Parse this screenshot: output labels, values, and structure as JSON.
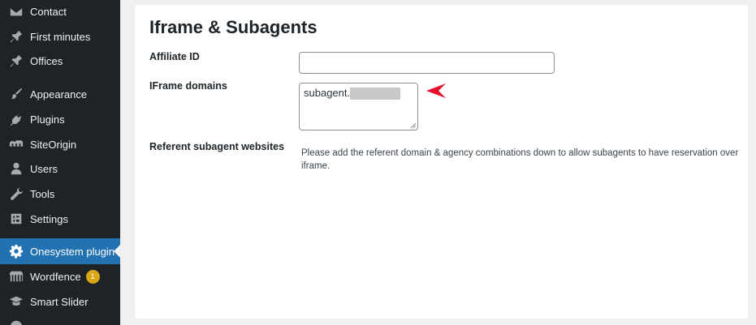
{
  "sidebar": {
    "items": [
      {
        "label": "Contact",
        "icon": "envelope-icon"
      },
      {
        "label": "First minutes",
        "icon": "pin-icon"
      },
      {
        "label": "Offices",
        "icon": "pin-icon"
      },
      {
        "label": "Appearance",
        "icon": "paintbrush-icon"
      },
      {
        "label": "Plugins",
        "icon": "plug-icon"
      },
      {
        "label": "SiteOrigin",
        "icon": "siteorigin-icon"
      },
      {
        "label": "Users",
        "icon": "user-icon"
      },
      {
        "label": "Tools",
        "icon": "wrench-icon"
      },
      {
        "label": "Settings",
        "icon": "settings-icon"
      },
      {
        "label": "Onesystem plugin",
        "icon": "gear-icon",
        "active": true
      },
      {
        "label": "Wordfence",
        "icon": "wordfence-icon",
        "badge": "1"
      },
      {
        "label": "Smart Slider",
        "icon": "graduation-cap-icon"
      }
    ],
    "colors": {
      "background": "#1d2327",
      "active": "#2271b1",
      "text": "#f0f0f1",
      "icon": "#a7aaad",
      "badge": "#dba617"
    }
  },
  "main": {
    "title": "Iframe & Subagents",
    "fields": {
      "affiliate_id": {
        "label": "Affiliate ID",
        "value": ""
      },
      "iframe_domains": {
        "label": "IFrame domains",
        "value": "subagent."
      },
      "referent_subagent": {
        "label": "Referent subagent websites",
        "description": "Please add the referent domain & agency combinations down to allow subagents to have reservation over iframe."
      }
    },
    "annotation": {
      "type": "arrow",
      "color": "#e8112d"
    }
  }
}
